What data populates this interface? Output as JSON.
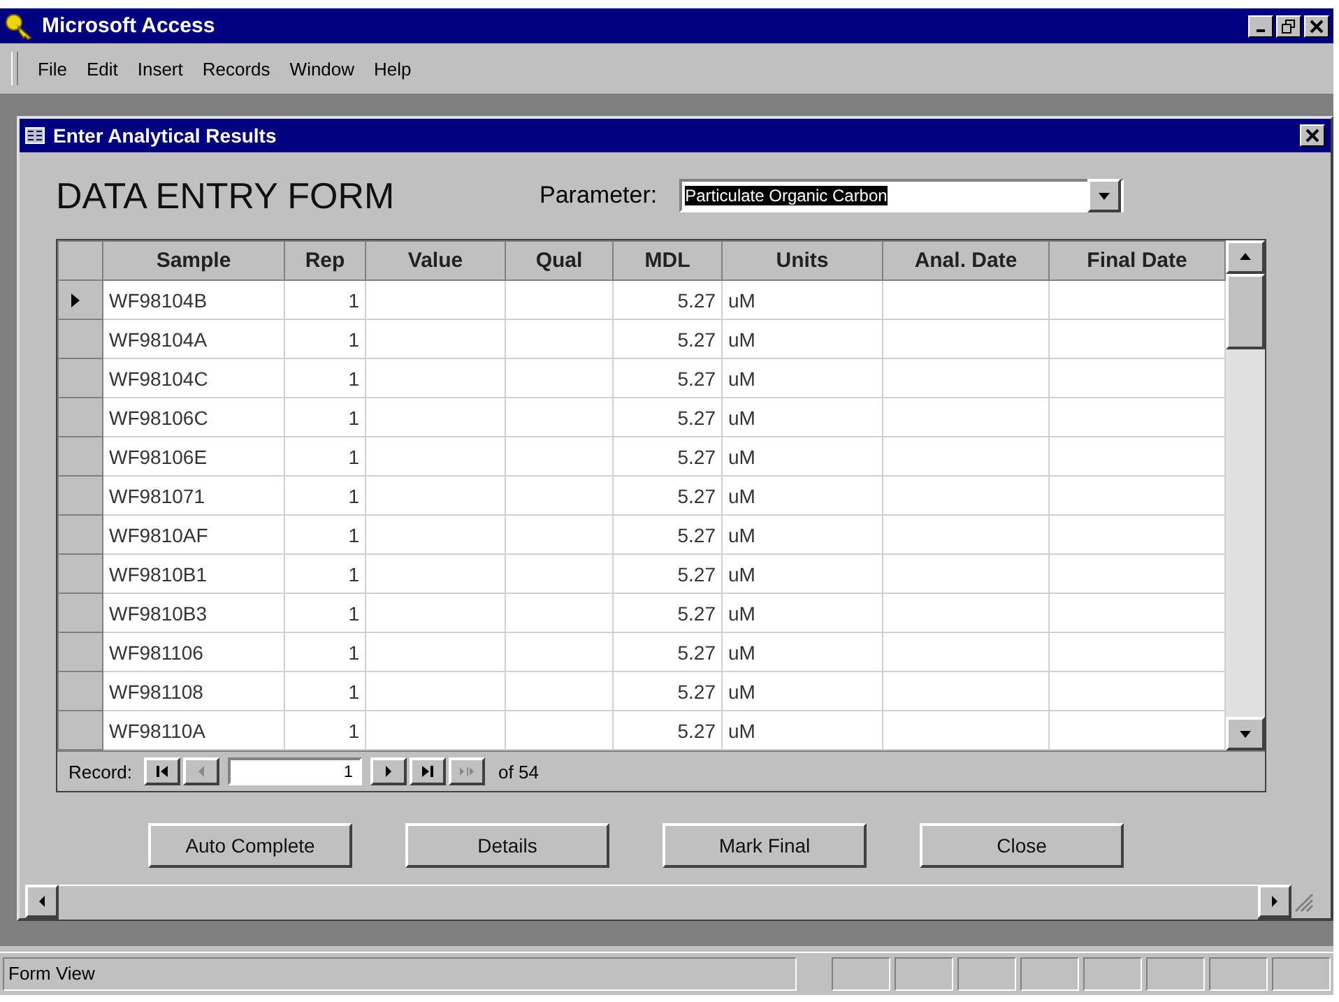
{
  "window": {
    "title": "Microsoft Access"
  },
  "menu": [
    "File",
    "Edit",
    "Insert",
    "Records",
    "Window",
    "Help"
  ],
  "form": {
    "title": "Enter Analytical Results",
    "heading": "DATA ENTRY FORM",
    "parameter": {
      "label": "Parameter:",
      "value": "Particulate Organic Carbon",
      "selected": true
    },
    "table": {
      "columns": [
        "Sample",
        "Rep",
        "Value",
        "Qual",
        "MDL",
        "Units",
        "Anal. Date",
        "Final Date"
      ],
      "rows": [
        {
          "current": true,
          "sample": "WF98104B",
          "rep": "1",
          "mdl": "5.27",
          "units": "uM"
        },
        {
          "current": false,
          "sample": "WF98104A",
          "rep": "1",
          "mdl": "5.27",
          "units": "uM"
        },
        {
          "current": false,
          "sample": "WF98104C",
          "rep": "1",
          "mdl": "5.27",
          "units": "uM"
        },
        {
          "current": false,
          "sample": "WF98106C",
          "rep": "1",
          "mdl": "5.27",
          "units": "uM"
        },
        {
          "current": false,
          "sample": "WF98106E",
          "rep": "1",
          "mdl": "5.27",
          "units": "uM"
        },
        {
          "current": false,
          "sample": "WF981071",
          "rep": "1",
          "mdl": "5.27",
          "units": "uM"
        },
        {
          "current": false,
          "sample": "WF9810AF",
          "rep": "1",
          "mdl": "5.27",
          "units": "uM"
        },
        {
          "current": false,
          "sample": "WF9810B1",
          "rep": "1",
          "mdl": "5.27",
          "units": "uM"
        },
        {
          "current": false,
          "sample": "WF9810B3",
          "rep": "1",
          "mdl": "5.27",
          "units": "uM"
        },
        {
          "current": false,
          "sample": "WF981106",
          "rep": "1",
          "mdl": "5.27",
          "units": "uM"
        },
        {
          "current": false,
          "sample": "WF981108",
          "rep": "1",
          "mdl": "5.27",
          "units": "uM"
        },
        {
          "current": false,
          "sample": "WF98110A",
          "rep": "1",
          "mdl": "5.27",
          "units": "uM"
        }
      ]
    },
    "navigator": {
      "label": "Record:",
      "record": "1",
      "total": "of 54",
      "buttons": [
        {
          "kind": "first",
          "disabled": false
        },
        {
          "kind": "prev",
          "disabled": true
        },
        {
          "kind": "next",
          "disabled": false
        },
        {
          "kind": "last",
          "disabled": false
        },
        {
          "kind": "new",
          "disabled": true
        }
      ]
    },
    "buttons": [
      "Auto Complete",
      "Details",
      "Mark Final",
      "Close"
    ]
  },
  "status_bar": {
    "text": "Form View"
  }
}
